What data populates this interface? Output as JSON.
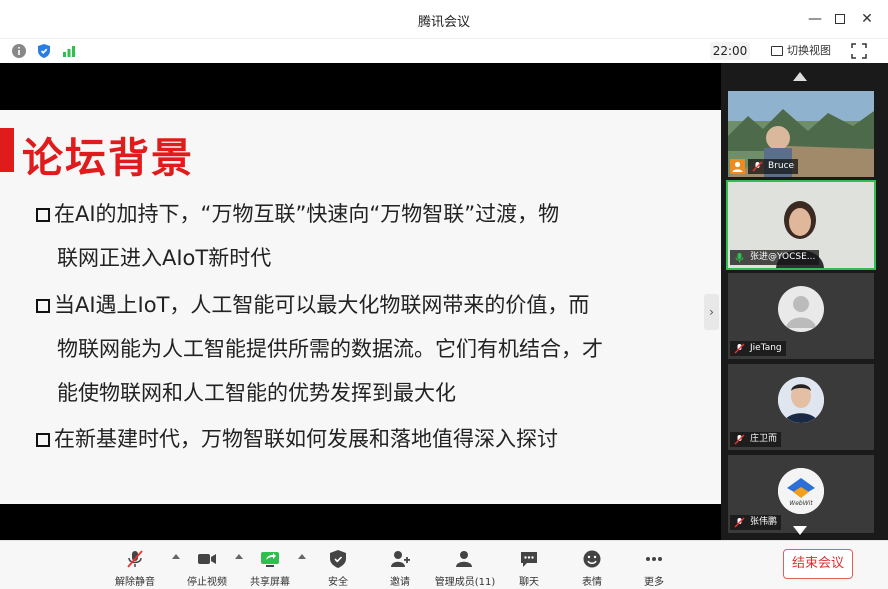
{
  "window": {
    "title": "腾讯会议"
  },
  "status": {
    "time": "22:00",
    "switch_view": "切换视图"
  },
  "slide": {
    "title": "论坛背景",
    "bullets": [
      {
        "lines": [
          "在AI的加持下，“万物互联”快速向“万物智联”过渡，物",
          "联网正进入AIoT新时代"
        ]
      },
      {
        "lines": [
          "当AI遇上IoT，人工智能可以最大化物联网带来的价值，而",
          "物联网能为人工智能提供所需的数据流。它们有机结合，才",
          "能使物联网和人工智能的优势发挥到最大化"
        ]
      },
      {
        "lines": [
          "在新基建时代，万物智联如何发展和落地值得深入探讨"
        ]
      }
    ]
  },
  "participants": [
    {
      "name": "Bruce"
    },
    {
      "name": "张进@YOCSE..."
    },
    {
      "name": "JieTang"
    },
    {
      "name": "庄卫而"
    },
    {
      "name": "张伟鹏",
      "avatar_text": "WebWit"
    }
  ],
  "toolbar": {
    "unmute": "解除静音",
    "stop_video": "停止视频",
    "share_screen": "共享屏幕",
    "security": "安全",
    "invite": "邀请",
    "manage_members": "管理成员(11)",
    "chat": "聊天",
    "reactions": "表情",
    "more": "更多",
    "end_meeting": "结束会议"
  },
  "colors": {
    "accent_red": "#e01b1b",
    "active_green": "#2fbf4f"
  }
}
